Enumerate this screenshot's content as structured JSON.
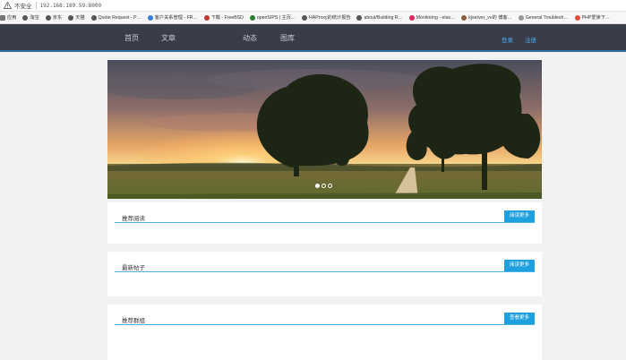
{
  "browser": {
    "insecure_label": "不安全",
    "url": "192.168.189.59:8000",
    "bookmarks": [
      {
        "label": "应用",
        "icon": "apps-icon",
        "color": "#777777"
      },
      {
        "label": "淘宝",
        "icon": "globe-icon",
        "color": "#555555"
      },
      {
        "label": "京东",
        "icon": "globe-icon",
        "color": "#555555"
      },
      {
        "label": "天猫",
        "icon": "globe-icon",
        "color": "#555555"
      },
      {
        "label": "Quote Request - P…",
        "icon": "globe-icon",
        "color": "#555555"
      },
      {
        "label": "客户关系管理 - FR…",
        "icon": "globe-icon",
        "color": "#3b7dd8"
      },
      {
        "label": "下载 - FreeBSD",
        "icon": "freebsd-icon",
        "color": "#c0392b"
      },
      {
        "label": "openSIPS | 主页…",
        "icon": "opensips-icon",
        "color": "#2e7d32"
      },
      {
        "label": "HAProxy的统计报告",
        "icon": "globe-icon",
        "color": "#555555"
      },
      {
        "label": "about/Building R…",
        "icon": "globe-icon",
        "color": "#555555"
      },
      {
        "label": "Monitoring - elas…",
        "icon": "elastic-icon",
        "color": "#e0245e"
      },
      {
        "label": "kjserver_vv的 博客…",
        "icon": "blog-icon",
        "color": "#8e5b3a"
      },
      {
        "label": "General Troublesh…",
        "icon": "globe-icon",
        "color": "#999999"
      },
      {
        "label": "PHP爱读下…",
        "icon": "php-icon",
        "color": "#e74c3c"
      }
    ]
  },
  "nav": {
    "home": "首页",
    "articles": "文章",
    "news": "动态",
    "gallery": "图库",
    "login": "登录",
    "register": "注册"
  },
  "carousel": {
    "slide_count": 3,
    "active_index": 0
  },
  "sections": [
    {
      "title": "推荐阅读",
      "button": "阅读更多"
    },
    {
      "title": "最新帖子",
      "button": "阅读更多"
    },
    {
      "title": "推荐群组",
      "button": "查看更多"
    }
  ],
  "colors": {
    "nav_bg": "#393d49",
    "accent": "#1e9fde",
    "link": "#4aa7e8"
  }
}
